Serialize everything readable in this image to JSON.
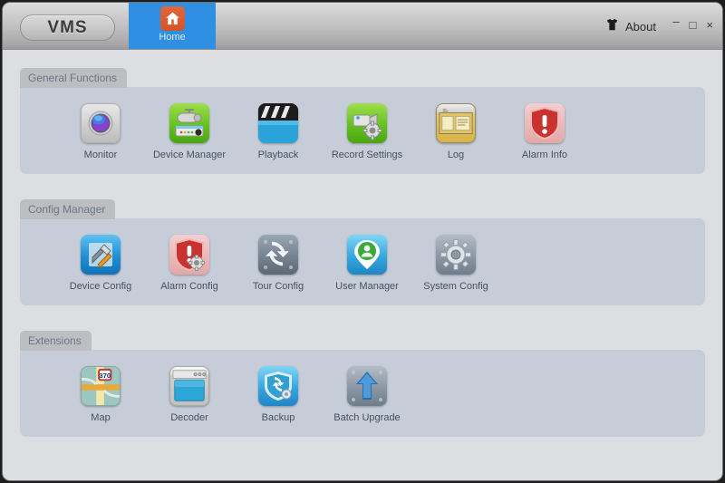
{
  "window": {
    "logo": "VMS",
    "controls": {
      "minimize": "–",
      "maximize": "□",
      "close": "×"
    }
  },
  "titlebar": {
    "home_tab": {
      "label": "Home",
      "icon": "home-icon",
      "active_color": "#2f8fe3",
      "icon_color": "#d4542a"
    },
    "about": {
      "label": "About",
      "icon": "tshirt-icon"
    }
  },
  "sections": [
    {
      "title": "General Functions",
      "items": [
        {
          "label": "Monitor",
          "icon": "dome-camera-icon",
          "tile": "t-silver"
        },
        {
          "label": "Device Manager",
          "icon": "camera-device-icon",
          "tile": "t-green"
        },
        {
          "label": "Playback",
          "icon": "clapperboard-icon",
          "tile": "t-black"
        },
        {
          "label": "Record Settings",
          "icon": "camera-gear-icon",
          "tile": "t-green"
        },
        {
          "label": "Log",
          "icon": "document-window-icon",
          "tile": "t-gold"
        },
        {
          "label": "Alarm Info",
          "icon": "shield-alert-icon",
          "tile": "t-red"
        }
      ]
    },
    {
      "title": "Config Manager",
      "items": [
        {
          "label": "Device Config",
          "icon": "wrench-hammer-icon",
          "tile": "t-blue"
        },
        {
          "label": "Alarm Config",
          "icon": "shield-alert-gear-icon",
          "tile": "t-red"
        },
        {
          "label": "Tour Config",
          "icon": "refresh-cycle-icon",
          "tile": "t-slate"
        },
        {
          "label": "User Manager",
          "icon": "user-pin-icon",
          "tile": "t-cyan"
        },
        {
          "label": "System Config",
          "icon": "gear-icon",
          "tile": "t-steel"
        }
      ]
    },
    {
      "title": "Extensions",
      "items": [
        {
          "label": "Map",
          "icon": "road-map-icon",
          "tile": "t-map"
        },
        {
          "label": "Decoder",
          "icon": "app-window-icon",
          "tile": "t-win"
        },
        {
          "label": "Backup",
          "icon": "shield-sync-icon",
          "tile": "t-cyan"
        },
        {
          "label": "Batch Upgrade",
          "icon": "arrow-up-icon",
          "tile": "t-steel"
        }
      ]
    }
  ],
  "colors": {
    "page_background": "#dcdee1",
    "panel_background": "#c6cdd8",
    "panel_header": "#bcbec1",
    "accent_blue": "#2f8fe3",
    "label_text": "#46505e"
  }
}
